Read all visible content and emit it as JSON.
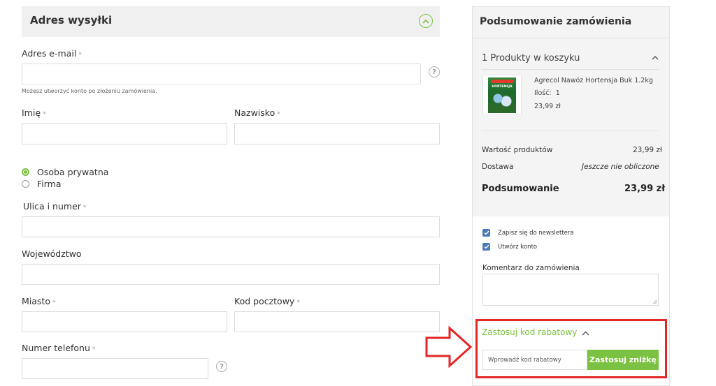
{
  "shipping": {
    "title": "Adres wysyłki",
    "email_label": "Adres e-mail",
    "email_hint": "Możesz utworzyć konto po złożeniu zamówienia.",
    "first_name_label": "Imię",
    "last_name_label": "Nazwisko",
    "customer_type": {
      "options": [
        "Osoba prywatna",
        "Firma"
      ],
      "selected": "Osoba prywatna"
    },
    "street_label": "Ulica i numer",
    "region_label": "Województwo",
    "city_label": "Miasto",
    "postal_label": "Kod pocztowy",
    "phone_label": "Numer telefonu",
    "required_mark": "*",
    "help_glyph": "?"
  },
  "summary": {
    "title": "Podsumowanie zamówienia",
    "cart_count_label": "1 Produkty w koszyku",
    "product": {
      "name": "Agrecol Nawóz Hortensja Buk 1.2kg",
      "qty_label": "Ilość:",
      "qty": "1",
      "price": "23,99 zł",
      "image_text": "HORTENSJA"
    },
    "products_value_label": "Wartość produktów",
    "products_value": "23,99 zł",
    "shipping_label": "Dostawa",
    "shipping_value": "Jeszcze nie obliczone",
    "total_label": "Podsumowanie",
    "total_value": "23,99 zł",
    "newsletter_label": "Zapisz się do newslettera",
    "create_account_label": "Utwórz konto",
    "comment_label": "Komentarz do zamówienia",
    "discount": {
      "toggle_label": "Zastosuj kod rabatowy",
      "placeholder": "Wprowadź kod rabatowy",
      "button_label": "Zastosuj zniżkę"
    }
  },
  "colors": {
    "accent_green": "#7cc242",
    "highlight_red": "#e32626",
    "checkbox_blue": "#4b7ab5"
  }
}
